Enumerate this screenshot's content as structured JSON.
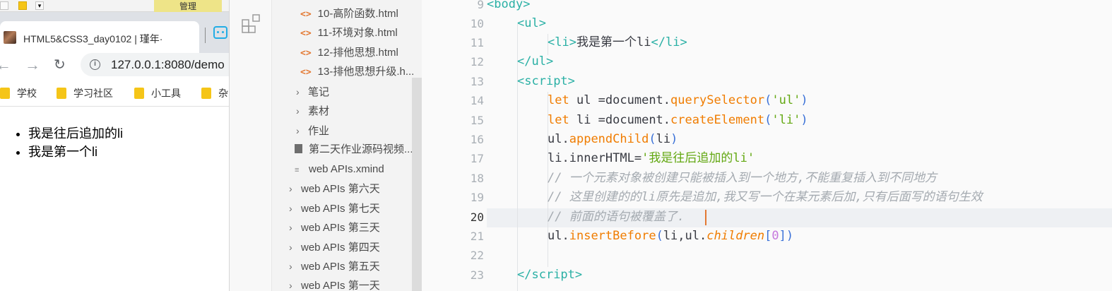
{
  "excel": {
    "manage_label": "管理"
  },
  "browser": {
    "tab_title": "HTML5&CSS3_day0102 | 瑾年·",
    "url": "127.0.0.1:8080/demo",
    "bookmarks": [
      "学校",
      "学习社区",
      "小工具",
      "杂"
    ],
    "page_list": [
      "我是往后追加的li",
      "我是第一个li"
    ]
  },
  "explorer": {
    "items": [
      {
        "type": "html",
        "label": "10-高阶函数.html"
      },
      {
        "type": "html",
        "label": "11-环境对象.html"
      },
      {
        "type": "html",
        "label": "12-排他思想.html"
      },
      {
        "type": "html",
        "label": "13-排他思想升级.h..."
      },
      {
        "type": "folder",
        "label": "笔记"
      },
      {
        "type": "folder",
        "label": "素材"
      },
      {
        "type": "folder",
        "label": "作业"
      },
      {
        "type": "file",
        "label": "第二天作业源码视频..."
      },
      {
        "type": "lines",
        "label": "web APIs.xmind"
      },
      {
        "type": "folder2",
        "label": "web APIs 第六天"
      },
      {
        "type": "folder2",
        "label": "web APIs 第七天"
      },
      {
        "type": "folder2",
        "label": "web APIs 第三天"
      },
      {
        "type": "folder2",
        "label": "web APIs 第四天"
      },
      {
        "type": "folder2",
        "label": "web APIs 第五天"
      },
      {
        "type": "folder2",
        "label": "web APIs 第一天"
      }
    ]
  },
  "editor": {
    "active_line": 20,
    "lines": [
      {
        "num": 9
      },
      {
        "num": 10
      },
      {
        "num": 11
      },
      {
        "num": 12
      },
      {
        "num": 13
      },
      {
        "num": 14
      },
      {
        "num": 15
      },
      {
        "num": 16
      },
      {
        "num": 17
      },
      {
        "num": 18
      },
      {
        "num": 19
      },
      {
        "num": 20
      },
      {
        "num": 21
      },
      {
        "num": 22
      },
      {
        "num": 23
      }
    ],
    "code": {
      "l9": "body",
      "l10": "ul",
      "l11_tag": "li",
      "l11_text": "我是第一个li",
      "l12": "/ul",
      "l13": "script",
      "l14": {
        "kw": "let",
        "var": " ul =",
        "obj": "document",
        "fn": "querySelector",
        "arg": "'ul'"
      },
      "l15": {
        "kw": "let",
        "var": " li =",
        "obj": "document",
        "fn": "createElement",
        "arg": "'li'"
      },
      "l16": {
        "obj": "ul",
        "fn": "appendChild",
        "arg": "li"
      },
      "l17": {
        "obj": "li",
        "prop": "innerHTML",
        "str": "'我是往后追加的li'"
      },
      "l18": "// 一个元素对象被创建只能被插入到一个地方,不能重复插入到不同地方",
      "l19": "// 这里创建的的li原先是追加,我又写一个在某元素后加,只有后面写的语句生效",
      "l20": "// 前面的语句被覆盖了.",
      "l21": {
        "obj": "ul",
        "fn": "insertBefore",
        "arg1": "li,ul",
        "prop": "children",
        "idx": "0"
      },
      "l23": "/script"
    }
  },
  "colors": {
    "tag": "#2ab0a5",
    "keyword": "#f07c00",
    "string": "#63a812",
    "comment": "#a4aab0",
    "html_icon": "#e37933"
  }
}
